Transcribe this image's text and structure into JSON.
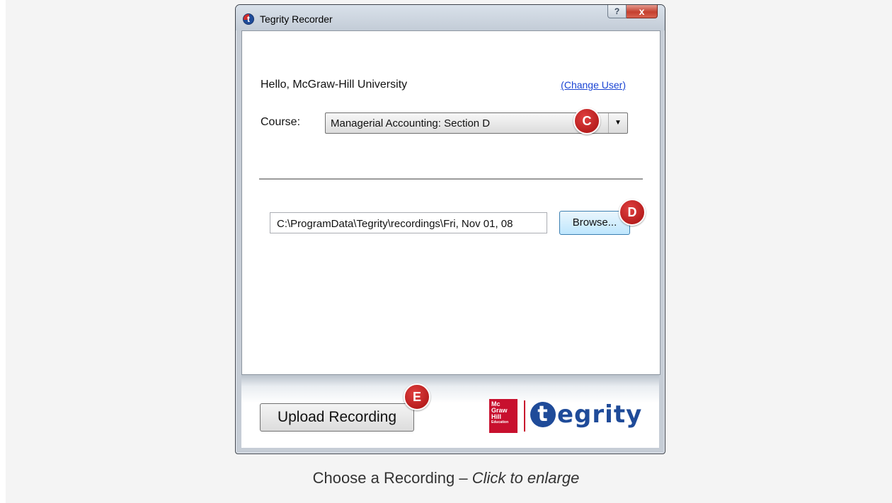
{
  "window": {
    "title": "Tegrity Recorder",
    "help_label": "?",
    "close_label": "x"
  },
  "greeting": {
    "hello_text": "Hello,  McGraw-Hill University",
    "change_user_link": "(Change User)"
  },
  "course": {
    "label": "Course:",
    "selected_value": "Managerial Accounting: Section D"
  },
  "recording_path": {
    "value": "C:\\ProgramData\\Tegrity\\recordings\\Fri, Nov 01, 08",
    "browse_label": "Browse..."
  },
  "footer": {
    "upload_label": "Upload Recording",
    "mh_logo_lines": [
      "Mc",
      "Graw",
      "Hill",
      "Education"
    ],
    "tegrity_logo_text": "egrity",
    "tegrity_logo_mark": "t"
  },
  "badges": {
    "c": "C",
    "d": "D",
    "e": "E"
  },
  "caption": {
    "main": "Choose a Recording – ",
    "emphasis": "Click to enlarge"
  },
  "colors": {
    "accent_red": "#c8102e",
    "tegrity_blue": "#1f4b99",
    "link_blue": "#1a44d3"
  }
}
